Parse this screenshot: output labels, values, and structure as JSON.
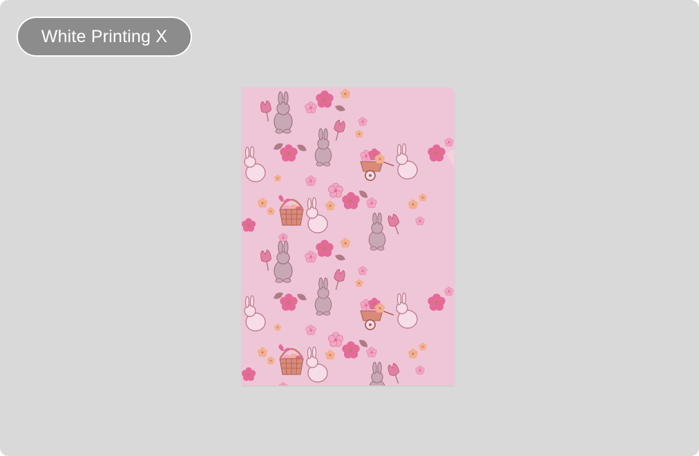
{
  "badge": {
    "label": "White Printing X"
  },
  "product_preview": {
    "description_icon": "easter-pattern-folder",
    "colors": {
      "background": "#efc6d8",
      "bunny": "#c9a8b6",
      "bunny_line": "#9e6f80",
      "flower_pink": "#e46a98",
      "flower_light": "#f3a6c4",
      "flower_peach": "#f2b08e",
      "leaf": "#b07a86",
      "basket": "#c9786a",
      "tulip": "#e27fa4"
    }
  }
}
